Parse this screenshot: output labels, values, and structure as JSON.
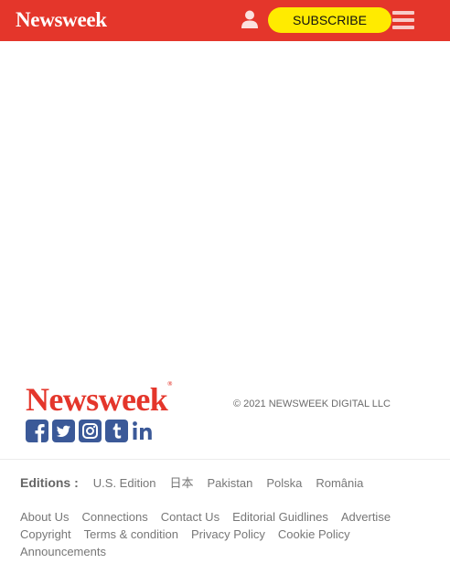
{
  "header": {
    "logo": "Newsweek",
    "subscribe_label": "SUBSCRIBE",
    "accent_color": "#e4362b",
    "button_color": "#ffeb00",
    "user_icon": "user-icon",
    "menu_icon": "hamburger-menu-icon"
  },
  "footer": {
    "logo": "Newsweek",
    "logo_mark": "®",
    "copyright": "© 2021 NEWSWEEK DIGITAL LLC",
    "social": [
      "facebook-icon",
      "twitter-icon",
      "instagram-icon",
      "tumblr-icon",
      "linkedin-icon"
    ],
    "editions_title": "Editions :",
    "editions": [
      "U.S. Edition",
      "日本",
      "Pakistan",
      "Polska",
      "România"
    ],
    "links": [
      "About Us",
      "Connections",
      "Contact Us",
      "Editorial Guidlines",
      "Advertise",
      "Copyright",
      "Terms & condition",
      "Privacy Policy",
      "Cookie Policy",
      "Announcements"
    ]
  }
}
